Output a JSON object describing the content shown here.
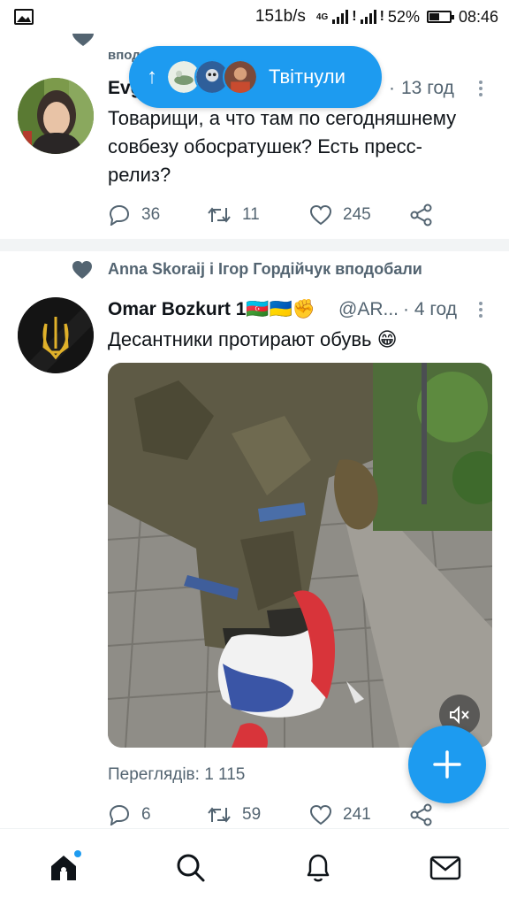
{
  "status_bar": {
    "network_speed": "151b/s",
    "network_type": "4G",
    "battery_percent": "52%",
    "battery_level": 0.52,
    "time": "08:46"
  },
  "new_tweets_pill": {
    "label": "Твітнули",
    "arrow": "↑"
  },
  "cut_tweet": {
    "social_context": "вподоб",
    "author_name": "Evg",
    "timestamp": "13 год",
    "text": "Товарищи, а что там по сегодняшнему совбезу обосратушек? Есть пресс-релиз?",
    "replies": "36",
    "retweets": "11",
    "likes": "245"
  },
  "tweet2": {
    "social_context": "Anna Skoraij і Ігор Гордійчук вподобали",
    "author_name": "Omar Bozkurt 1🇦🇿🇺🇦✊",
    "handle": "@AR...",
    "timestamp": "· 4 год",
    "text": "Десантники протирают обувь 😁",
    "views_label": "Переглядів: 1 115",
    "replies": "6",
    "retweets": "59",
    "likes": "241"
  },
  "colors": {
    "accent": "#1d9bf0",
    "muted": "#536471",
    "text": "#0f1419"
  },
  "icons": {
    "status_left": "image-icon",
    "nav": [
      "home-icon",
      "search-icon",
      "notifications-bell-icon",
      "messages-envelope-icon"
    ],
    "fab": "plus-icon",
    "media": "mute-icon"
  }
}
